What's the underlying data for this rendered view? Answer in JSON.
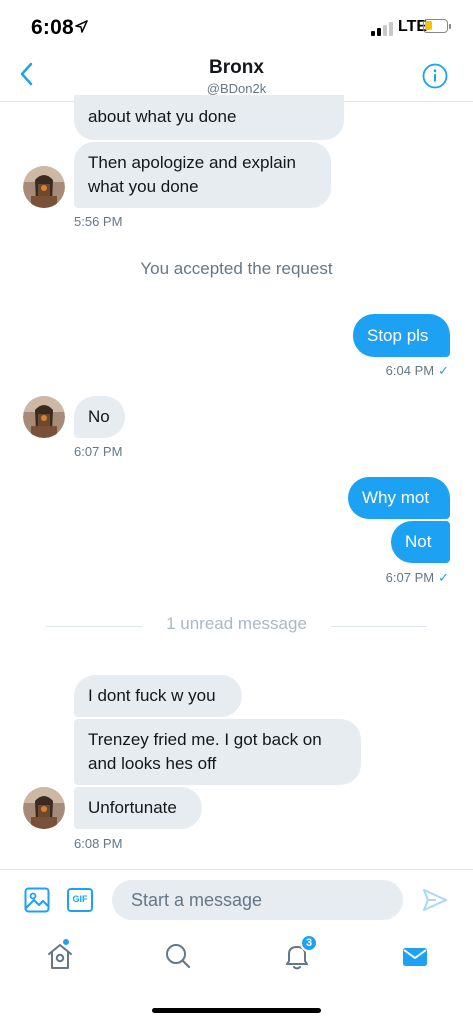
{
  "status_bar": {
    "time": "6:08",
    "network": "LTE"
  },
  "header": {
    "title": "Bronx",
    "handle": "@BDon2k"
  },
  "messages": {
    "m1": "about what yu done",
    "m2_line1": "Then apologize and explain",
    "m2_line2": "what you done",
    "ts1": "5:56 PM",
    "system_notice": "You accepted the request",
    "m3": "Stop pls",
    "ts2": "6:04 PM",
    "m4": "No",
    "ts3": "6:07 PM",
    "m5": "Why mot",
    "m6": "Not",
    "ts4": "6:07 PM",
    "unread_label": "1 unread message",
    "m7": "I dont fuck w you",
    "m8_line1": "Trenzey fried me. I got back on",
    "m8_line2": "and looks hes off",
    "m9": "Unfortunate",
    "ts5": "6:08 PM",
    "read_check": "✓"
  },
  "composer": {
    "placeholder": "Start a message",
    "gif_label": "GIF"
  },
  "tabbar": {
    "notifications_count": "3"
  },
  "colors": {
    "accent": "#1da1f2",
    "bubble_in": "#e6ecf0",
    "muted": "#657786"
  },
  "icons": [
    "location-arrow-icon",
    "signal-icon",
    "battery-icon",
    "back-chevron-icon",
    "info-icon",
    "avatar",
    "image-icon",
    "gif-icon",
    "send-icon",
    "home-icon",
    "search-icon",
    "bell-icon",
    "mail-icon"
  ]
}
